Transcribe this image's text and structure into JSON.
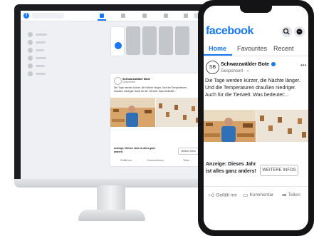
{
  "desktop": {
    "post": {
      "page_name": "Schwarzwälder Bote",
      "sub": "Gesponsert",
      "text": "Die Tage werden kürzer, die Nächte länger. Und die Temperaturen draußen niedriger. Auch für die Tierwelt. Was bedeutet:...",
      "ad_text": "Anzeige: Dieses Jahr ist alles ganz anders!",
      "more_button": "Weitere Infos",
      "actions": {
        "like": "Gefällt mir",
        "comment": "Kommentieren",
        "share": "Teilen"
      }
    }
  },
  "phone": {
    "brand": "facebook",
    "tabs": {
      "home": "Home",
      "favourites": "Favourites",
      "recent": "Recent"
    },
    "post": {
      "avatar_initials": "SB",
      "page_name": "Schwarzwälder Bote",
      "sub": "Gesponsert · ",
      "text": "Die Tage werden kürzer, die Nächte länger. Und die Temperaturen draußen niedriger. Auch für die Tierwelt. Was bedeutet:...",
      "ad_text": "Anzeige: Dieses Jahr ist alles ganz anders!",
      "more_button": "WEITERE INFOS",
      "actions": {
        "like": "Gefällt mir",
        "comment": "Kommentar",
        "share": "Teilen"
      }
    }
  },
  "colors": {
    "brand": "#1877f2",
    "text": "#1c1e21",
    "muted": "#65676b"
  }
}
